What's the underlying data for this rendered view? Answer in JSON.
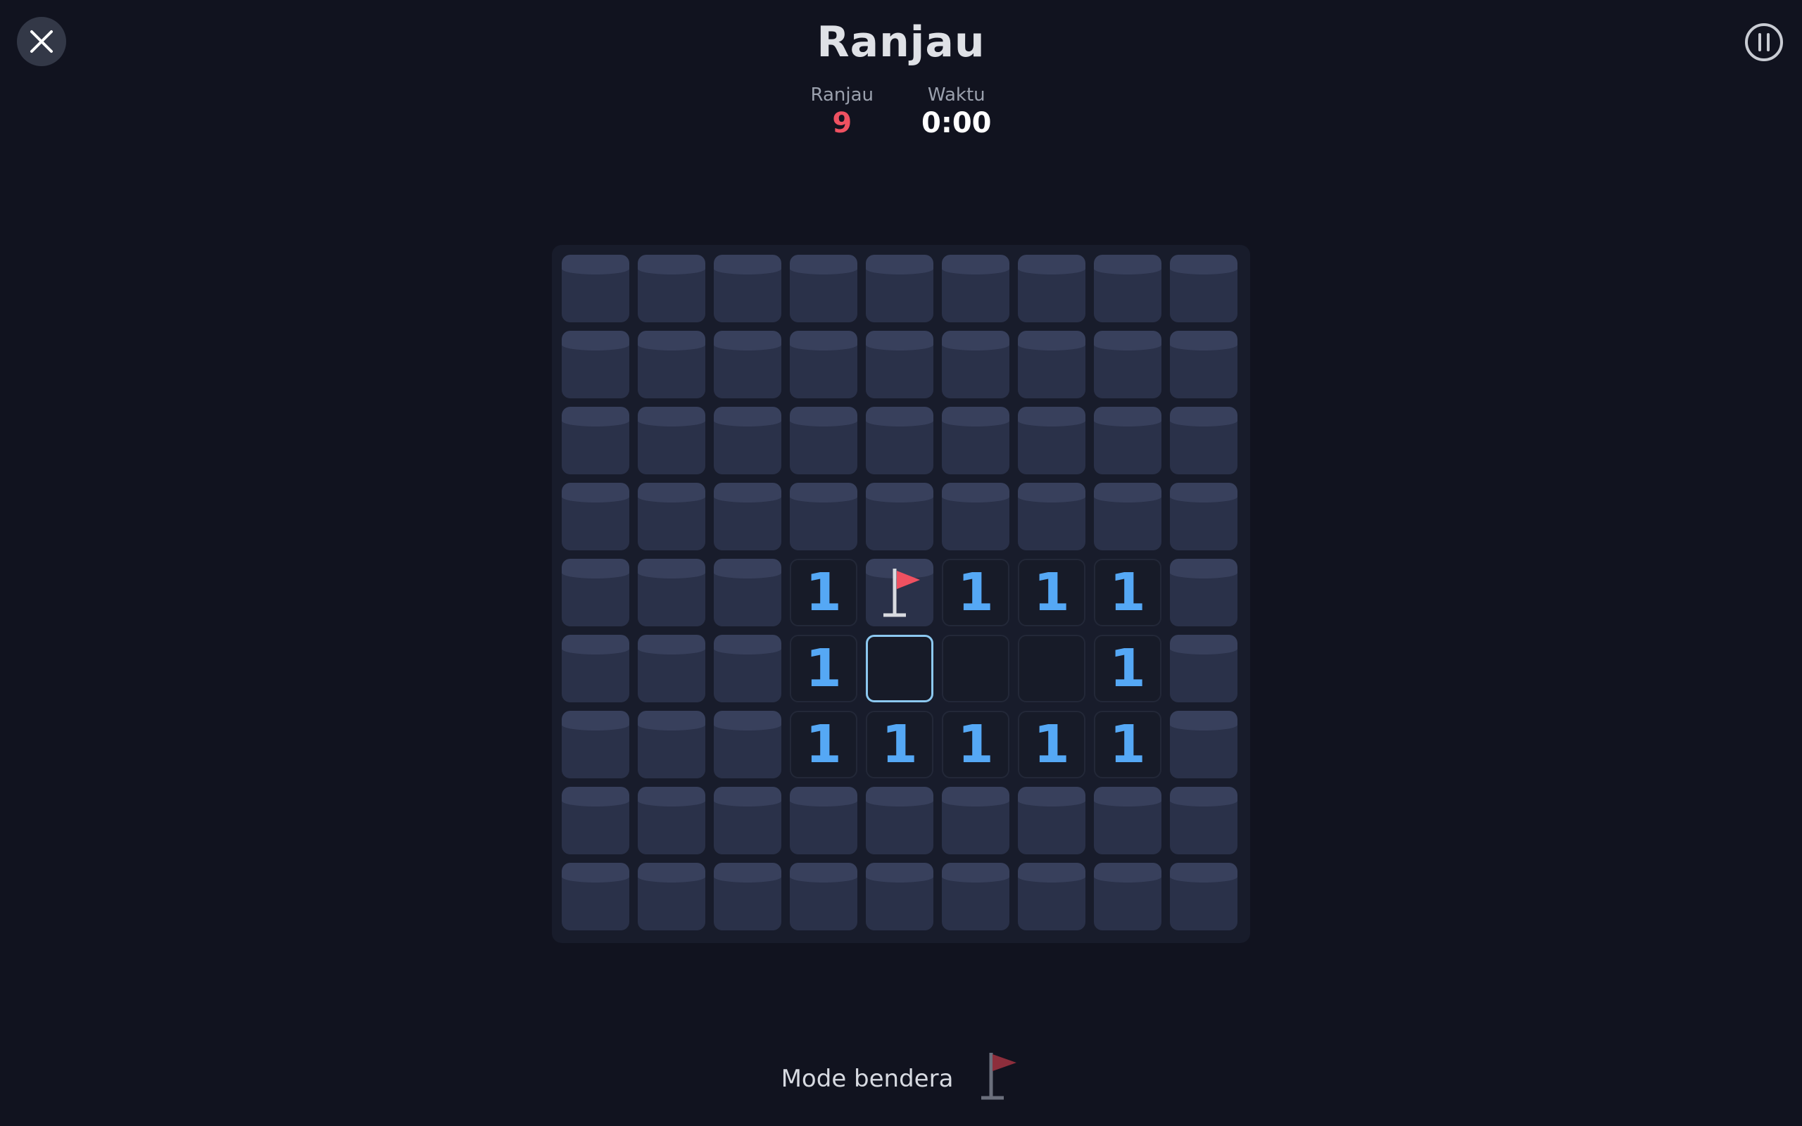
{
  "header": {
    "title": "Ranjau",
    "close_icon": "close-icon",
    "pause_icon": "pause-icon"
  },
  "stats": {
    "mines_label": "Ranjau",
    "mines_value": "9",
    "time_label": "Waktu",
    "time_value": "0:00"
  },
  "board": {
    "rows": 9,
    "cols": 9,
    "cells": [
      [
        "C",
        "C",
        "C",
        "C",
        "C",
        "C",
        "C",
        "C",
        "C"
      ],
      [
        "C",
        "C",
        "C",
        "C",
        "C",
        "C",
        "C",
        "C",
        "C"
      ],
      [
        "C",
        "C",
        "C",
        "C",
        "C",
        "C",
        "C",
        "C",
        "C"
      ],
      [
        "C",
        "C",
        "C",
        "C",
        "C",
        "C",
        "C",
        "C",
        "C"
      ],
      [
        "C",
        "C",
        "C",
        "1",
        "F",
        "1",
        "1",
        "1",
        "C"
      ],
      [
        "C",
        "C",
        "C",
        "1",
        "S",
        "0",
        "0",
        "1",
        "C"
      ],
      [
        "C",
        "C",
        "C",
        "1",
        "1",
        "1",
        "1",
        "1",
        "C"
      ],
      [
        "C",
        "C",
        "C",
        "C",
        "C",
        "C",
        "C",
        "C",
        "C"
      ],
      [
        "C",
        "C",
        "C",
        "C",
        "C",
        "C",
        "C",
        "C",
        "C"
      ]
    ],
    "legend": {
      "C": "covered",
      "F": "flagged",
      "0": "revealed-empty",
      "S": "revealed-empty-selected"
    }
  },
  "footer": {
    "flag_mode_label": "Mode bendera",
    "flag_mode_icon": "flag-icon"
  },
  "colors": {
    "background": "#11131f",
    "number": "#55a8f5",
    "mine_counter": "#ef5161",
    "flag": "#ef5161",
    "selected_border": "#8cc8f0"
  }
}
